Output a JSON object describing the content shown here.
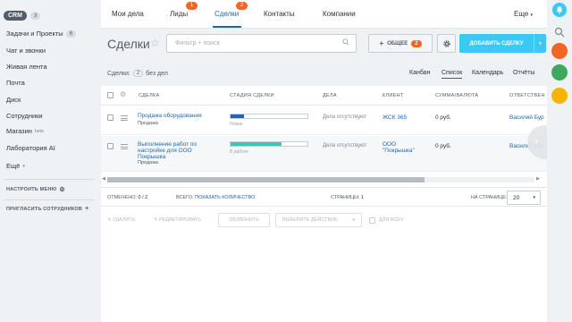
{
  "sidebar": {
    "crm_label": "CRM",
    "crm_count": "3",
    "items": [
      {
        "label": "Задачи и Проекты",
        "badge": "6"
      },
      {
        "label": "Чат и звонки"
      },
      {
        "label": "Живая лента"
      },
      {
        "label": "Почта"
      },
      {
        "label": "Диск"
      },
      {
        "label": "Сотрудники"
      },
      {
        "label": "Магазин",
        "sup": "beta"
      },
      {
        "label": "Лаборатория AI"
      },
      {
        "label": "Ещё"
      }
    ],
    "configure_menu": "НАСТРОИТЬ МЕНЮ",
    "invite": "ПРИГЛАСИТЬ СОТРУДНИКОВ"
  },
  "topnav": {
    "items": [
      {
        "label": "Мои дела"
      },
      {
        "label": "Лиды",
        "badge": "1"
      },
      {
        "label": "Сделки",
        "badge": "2",
        "active": true
      },
      {
        "label": "Контакты"
      },
      {
        "label": "Компании"
      }
    ],
    "more": "Еще"
  },
  "header": {
    "title": "Сделки",
    "filter_placeholder": "Фильтр + поиск",
    "common_label": "ОБЩЕЕ",
    "common_count": "2",
    "add_deal": "ДОБАВИТЬ СДЕЛКУ"
  },
  "subrow": {
    "deals_label": "Сделки:",
    "deals_count": "2",
    "no_deals": "без дел",
    "views": [
      "Канбан",
      "Список",
      "Календарь",
      "Отчёты"
    ],
    "active_view": "Список"
  },
  "table": {
    "columns": [
      "СДЕЛКА",
      "СТАДИЯ СДЕЛКИ",
      "ДЕЛА",
      "КЛИЕНТ",
      "СУММА/ВАЛЮТА",
      "ОТВЕТСТВЕН"
    ],
    "rows": [
      {
        "title": "Продажа оборудования",
        "type": "Продажа",
        "stage": "Новая",
        "stage_progress": 0.17,
        "stage_color": "#2067b0",
        "activities": "Дела отсутствуют",
        "client": "ЖСК 365",
        "sum": "0 руб.",
        "responsible": "Василий Бур"
      },
      {
        "title_line1": "Выполнение работ по",
        "title_line2": "настройке для ООО",
        "title_line3": "Покрышка",
        "type": "Продажа",
        "stage": "В работе",
        "stage_progress": 0.66,
        "stage_color": "#47c2b3",
        "activities": "Дела отсутствуют",
        "client_line1": "ООО",
        "client_line2": "\"Покрышка\"",
        "sum": "0 руб.",
        "responsible": "Василий Бур"
      }
    ]
  },
  "footer": {
    "selected_label": "ОТМЕЧЕНО:",
    "selected_value": "0 / 2",
    "total_label": "ВСЕГО:",
    "total_link": "ПОКАЗАТЬ КОЛИЧЕСТВО",
    "pages_label": "СТРАНИЦЫ:",
    "pages_value": "1",
    "per_page_label": "НА СТРАНИЦЕ:",
    "per_page_value": "20"
  },
  "actions": {
    "delete": "✕ УДАЛИТЬ",
    "edit": "✎ РЕДАКТИРОВАТЬ",
    "call": "ОБЗВОНИТЬ",
    "choose_action": "ВЫБЕРИТЕ ДЕЙСТВИЕ",
    "for_all": "ДЛЯ ВСЕХ"
  },
  "colors": {
    "accent": "#2067b0",
    "add_button": "#3bc8f5",
    "badge": "#f26522"
  }
}
